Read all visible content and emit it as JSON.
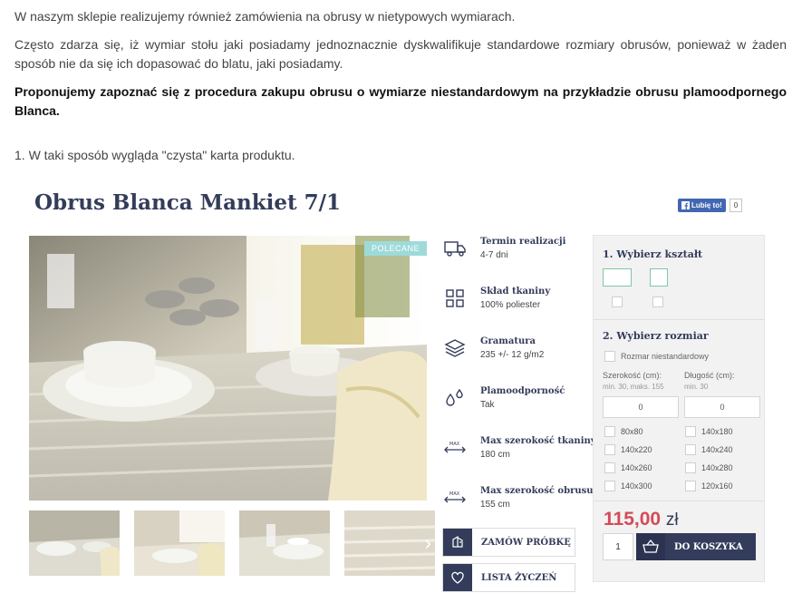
{
  "article": {
    "p1": "W naszym sklepie realizujemy również zamówienia na obrusy w nietypowych wymiarach.",
    "p2": "Często zdarza się, iż wymiar stołu jaki posiadamy jednoznacznie dyskwalifikuje standardowe rozmiary obrusów, ponieważ  w żaden sposób nie da się ich dopasować do blatu, jaki posiadamy.",
    "p3": "Proponujemy zapoznać się z procedura zakupu obrusu o wymiarze niestandardowym na przykładzie obrusu plamoodpornego Blanca.",
    "step1": "1. W taki sposób wygląda \"czysta\" karta  produktu."
  },
  "product": {
    "title": "Obrus Blanca Mankiet 7/1",
    "fb_like": "Lubię to!",
    "fb_count": "0",
    "badge": "POLECANE",
    "next_arrow": "›"
  },
  "attributes": [
    {
      "icon": "truck-icon",
      "label": "Termin realizacji",
      "value": "4-7 dni"
    },
    {
      "icon": "grid-icon",
      "label": "Skład tkaniny",
      "value": "100% poliester"
    },
    {
      "icon": "layers-icon",
      "label": "Gramatura",
      "value": "235 +/- 12 g/m2"
    },
    {
      "icon": "drops-icon",
      "label": "Plamoodporność",
      "value": "Tak"
    },
    {
      "icon": "max-width-icon",
      "label": "Max szerokość tkaniny",
      "value": "180 cm"
    },
    {
      "icon": "max-width-icon",
      "label": "Max szerokość obrusu",
      "value": "155 cm"
    }
  ],
  "attr_icon_text": "MAX",
  "actions": {
    "sample": "ZAMÓW PRÓBKĘ",
    "wishlist": "LISTA ŻYCZEŃ"
  },
  "config": {
    "shape_heading": "1. Wybierz kształt",
    "size_heading": "2. Wybierz rozmiar",
    "custom_size": "Rozmar niestandardowy",
    "width_label": "Szerokość (cm):",
    "width_hint": "min. 30, maks. 155",
    "length_label": "Długość (cm):",
    "length_hint": "min. 30",
    "width_value": "0",
    "length_value": "0",
    "sizes": [
      "80x80",
      "140x180",
      "140x220",
      "140x240",
      "140x260",
      "140x280",
      "140x300",
      "120x160"
    ],
    "price_amount": "115,00",
    "price_currency": "zł",
    "quantity": "1",
    "cart_label": "DO KOSZYKA"
  },
  "colors": {
    "navy": "#333c5a",
    "price_red": "#d34b59",
    "badge_teal": "#9edad9",
    "shape_green": "#7fc7a7",
    "fb_blue": "#4267b2"
  }
}
